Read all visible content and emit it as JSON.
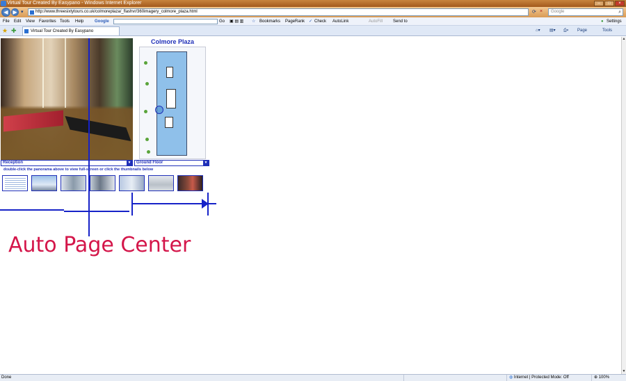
{
  "window": {
    "title": "Virtual Tour Created By Easypano - Windows Internet Explorer",
    "controls": [
      "–",
      "□",
      "×"
    ]
  },
  "address": {
    "url": "http://www.threesixtytours.co.uk/colmoreplaza/_flashvr/360imagery_colmore_plaza.html",
    "search_placeholder": "Google",
    "refresh_icon": "refresh-icon",
    "stop_label": "×"
  },
  "menu": {
    "items": [
      "File",
      "Edit",
      "View",
      "Favorites",
      "Tools",
      "Help"
    ]
  },
  "google_toolbar": {
    "brand": "Google",
    "go": "Go",
    "bookmarks": "Bookmarks",
    "pagerank": "PageRank",
    "check": "Check",
    "autolink": "AutoLink",
    "autofill": "AutoFill",
    "sendto": "Send to",
    "settings": "Settings"
  },
  "tabs": {
    "active_label": "Virtual Tour Created By Easypano"
  },
  "command_bar": {
    "page": "Page",
    "tools": "Tools"
  },
  "tour": {
    "plan_title": "Colmore Plaza",
    "scene_select": "Reception",
    "floor_select": "Ground Floor",
    "hint": "double-click the panorama above to view full-screen or click the thumbnails below"
  },
  "annotation": {
    "text": "Auto Page Center",
    "line_color": "#1622c8",
    "text_color": "#d4164a"
  },
  "status": {
    "done": "Done",
    "zone": "Internet | Protected Mode: Off",
    "zoom": "100%"
  }
}
